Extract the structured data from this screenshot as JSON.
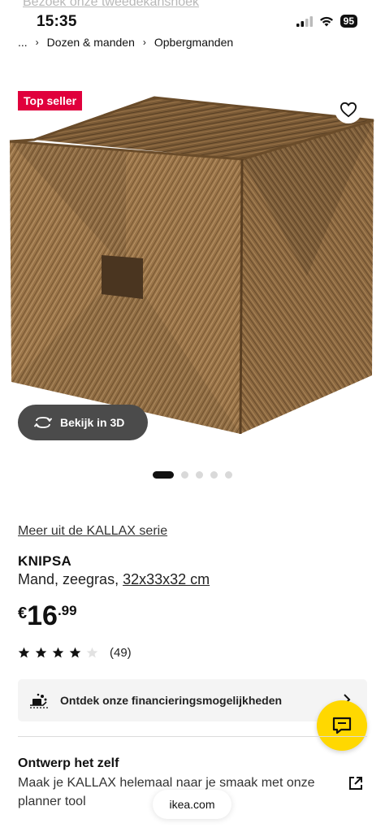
{
  "status_bar": {
    "ghost_text": "Bezoek onze tweedekanshoek",
    "time": "15:35",
    "battery": "95"
  },
  "breadcrumb": {
    "ellipsis": "...",
    "items": [
      "Dozen & manden",
      "Opbergmanden"
    ]
  },
  "product_image": {
    "badge": "Top seller",
    "view_3d_label": "Bekijk in 3D",
    "gallery_count": 5,
    "gallery_active_index": 0
  },
  "product": {
    "series_link": "Meer uit de KALLAX serie",
    "name": "KNIPSA",
    "description": "Mand, zeegras, ",
    "size": "32x33x32 cm",
    "price": {
      "currency": "€",
      "integer": "16",
      "decimal": ".99"
    },
    "rating": {
      "value": 4,
      "max": 5,
      "count_label": "(49)"
    }
  },
  "financing": {
    "label": "Ontdek onze financieringsmogelijkheden"
  },
  "design": {
    "title": "Ontwerp het zelf",
    "text": "Maak je KALLAX helemaal naar je smaak met onze planner tool"
  },
  "browser": {
    "url": "ikea.com"
  },
  "colors": {
    "badge": "#e0003c",
    "chat_button": "#ffd800",
    "view3d_button": "#4b4b4b",
    "basket": "#9a7448"
  }
}
